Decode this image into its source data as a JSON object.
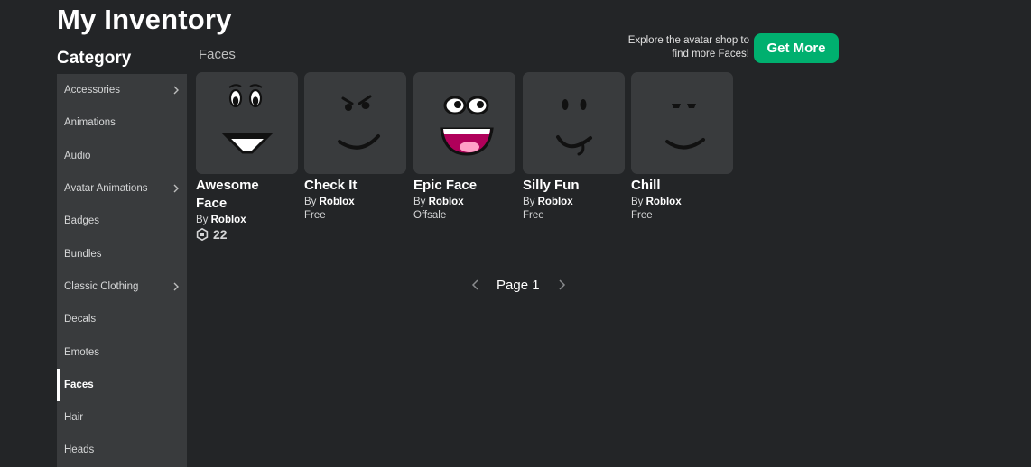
{
  "header": {
    "title": "My Inventory",
    "category_title": "Category"
  },
  "sidebar": {
    "items": [
      {
        "label": "Accessories",
        "has_submenu": true
      },
      {
        "label": "Animations",
        "has_submenu": false
      },
      {
        "label": "Audio",
        "has_submenu": false
      },
      {
        "label": "Avatar Animations",
        "has_submenu": true
      },
      {
        "label": "Badges",
        "has_submenu": false
      },
      {
        "label": "Bundles",
        "has_submenu": false
      },
      {
        "label": "Classic Clothing",
        "has_submenu": true
      },
      {
        "label": "Decals",
        "has_submenu": false
      },
      {
        "label": "Emotes",
        "has_submenu": false
      },
      {
        "label": "Faces",
        "has_submenu": false,
        "active": true
      },
      {
        "label": "Hair",
        "has_submenu": false
      },
      {
        "label": "Heads",
        "has_submenu": false
      }
    ]
  },
  "main": {
    "section_label": "Faces",
    "promo_line1": "Explore the avatar shop to",
    "promo_line2": "find more Faces!",
    "get_more_label": "Get More"
  },
  "items": [
    {
      "name_line1": "Awesome",
      "name_line2": "Face",
      "by": "By",
      "creator": "Roblox",
      "price": "",
      "robux": "22",
      "icon": "awesome-face-icon"
    },
    {
      "name_line1": "Check It",
      "name_line2": "",
      "by": "By",
      "creator": "Roblox",
      "price": "Free",
      "robux": "",
      "icon": "check-it-face-icon"
    },
    {
      "name_line1": "Epic Face",
      "name_line2": "",
      "by": "By",
      "creator": "Roblox",
      "price": "Offsale",
      "robux": "",
      "icon": "epic-face-icon"
    },
    {
      "name_line1": "Silly Fun",
      "name_line2": "",
      "by": "By",
      "creator": "Roblox",
      "price": "Free",
      "robux": "",
      "icon": "silly-fun-face-icon"
    },
    {
      "name_line1": "Chill",
      "name_line2": "",
      "by": "By",
      "creator": "Roblox",
      "price": "Free",
      "robux": "",
      "icon": "chill-face-icon"
    }
  ],
  "pagination": {
    "label": "Page 1"
  },
  "colors": {
    "background": "#232527",
    "sidebar": "#393b3d",
    "card": "#393b3d",
    "accent_green": "#00b06f"
  }
}
